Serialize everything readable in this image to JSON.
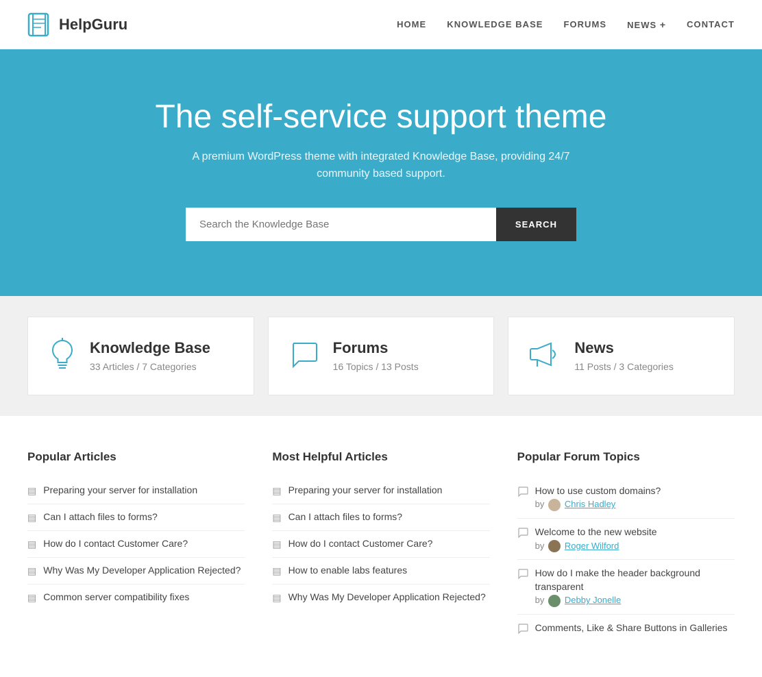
{
  "header": {
    "logo_text": "HelpGuru",
    "nav": [
      {
        "label": "HOME",
        "id": "home"
      },
      {
        "label": "KNOWLEDGE BASE",
        "id": "knowledge-base"
      },
      {
        "label": "FORUMS",
        "id": "forums"
      },
      {
        "label": "NEWS",
        "id": "news"
      },
      {
        "label": "CONTACT",
        "id": "contact"
      }
    ]
  },
  "hero": {
    "title": "The self-service support theme",
    "subtitle": "A premium WordPress theme with integrated Knowledge Base, providing 24/7 community based support.",
    "search_placeholder": "Search the Knowledge Base",
    "search_button": "SEARCH"
  },
  "stats": [
    {
      "id": "knowledge-base",
      "title": "Knowledge Base",
      "sub": "33 Articles / 7 Categories",
      "icon": "lightbulb"
    },
    {
      "id": "forums",
      "title": "Forums",
      "sub": "16 Topics / 13 Posts",
      "icon": "chat"
    },
    {
      "id": "news",
      "title": "News",
      "sub": "11 Posts / 3 Categories",
      "icon": "megaphone"
    }
  ],
  "popular_articles": {
    "heading": "Popular Articles",
    "items": [
      "Preparing your server for installation",
      "Can I attach files to forms?",
      "How do I contact Customer Care?",
      "Why Was My Developer Application Rejected?",
      "Common server compatibility fixes"
    ]
  },
  "helpful_articles": {
    "heading": "Most Helpful Articles",
    "items": [
      "Preparing your server for installation",
      "Can I attach files to forms?",
      "How do I contact Customer Care?",
      "How to enable labs features",
      "Why Was My Developer Application Rejected?"
    ]
  },
  "forum_topics": {
    "heading": "Popular Forum Topics",
    "items": [
      {
        "text": "How to use custom domains?",
        "by": "by",
        "author": "Chris Hadley",
        "avatar": "1"
      },
      {
        "text": "Welcome to the new website",
        "by": "by",
        "author": "Roger Wilford",
        "avatar": "2"
      },
      {
        "text": "How do I make the header background transparent",
        "by": "by",
        "author": "Debby Jonelle",
        "avatar": "3"
      },
      {
        "text": "Comments, Like & Share Buttons in Galleries",
        "by": "",
        "author": "",
        "avatar": ""
      }
    ]
  }
}
